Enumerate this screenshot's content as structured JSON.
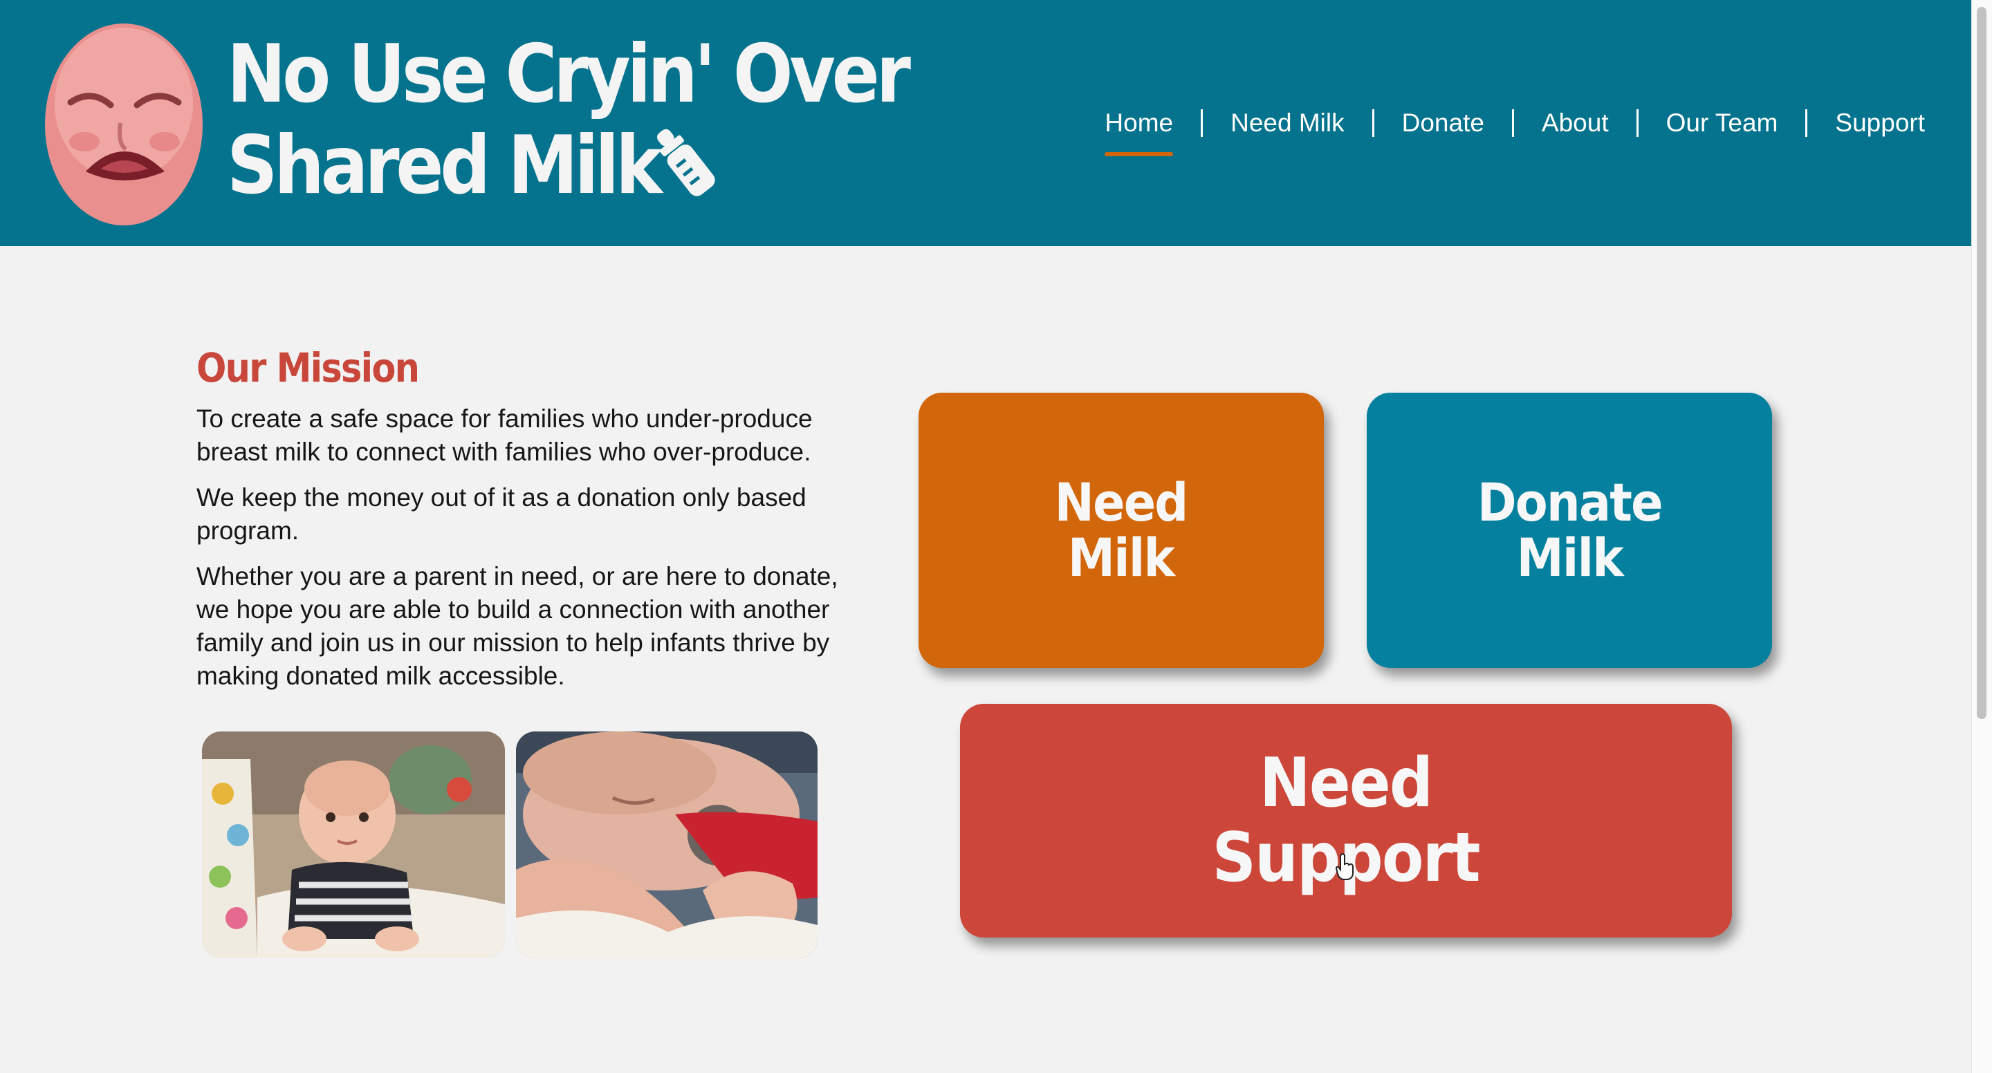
{
  "header": {
    "title_line1": "No Use Cryin' Over",
    "title_line2": "Shared Milk",
    "logo_icon": "crying-baby-face",
    "title_icon": "baby-bottle-icon",
    "background_color": "#05738d"
  },
  "nav": {
    "items": [
      {
        "label": "Home",
        "active": true
      },
      {
        "label": "Need Milk",
        "active": false
      },
      {
        "label": "Donate",
        "active": false
      },
      {
        "label": "About",
        "active": false
      },
      {
        "label": "Our Team",
        "active": false
      },
      {
        "label": "Support",
        "active": false
      }
    ],
    "active_indicator_color": "#d2660a"
  },
  "mission": {
    "heading": "Our Mission",
    "paragraphs": [
      "To create a safe space for families who under-produce breast milk to connect with families who over-produce.",
      "We keep the money out of it as a donation only based program.",
      "Whether you are a parent in need, or are here to donate, we hope you are able to build a connection with another family and join us in our mission to help infants thrive by making donated milk accessible."
    ],
    "heading_color": "#c9463a"
  },
  "photos": [
    {
      "subject": "baby-on-play-mat-photo"
    },
    {
      "subject": "sleeping-newborn-with-pacifier-photo"
    }
  ],
  "actions": {
    "need_milk": {
      "label": "Need\nMilk",
      "color": "#d2660a"
    },
    "donate_milk": {
      "label": "Donate\nMilk",
      "color": "#05809e"
    },
    "need_support": {
      "label": "Need\nSupport",
      "color": "#cc473a"
    }
  },
  "cursor": {
    "icon": "hand-pointer-icon"
  }
}
